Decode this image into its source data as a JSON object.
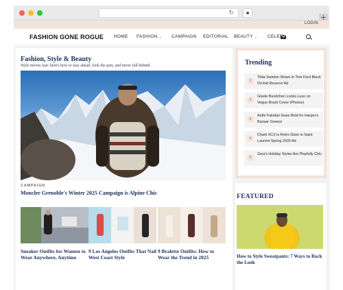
{
  "browser": {},
  "header": {
    "login": "LOGIN",
    "logo": "FASHION GONE ROGUE",
    "menu": {
      "home": "HOME",
      "fashion": "FASHION",
      "campaign": "CAMPAIGN",
      "editorial": "EDITORIAL",
      "beauty": "BEAUTY",
      "celeb": "CELEB"
    },
    "chevron": "⌄"
  },
  "main": {
    "section_title": "Fashion, Style & Beauty",
    "section_subtitle": "Style moves fast: here's how to stay ahead, look the part, and never fall behind.",
    "hero": {
      "label": "CAMPAIGN",
      "title": "Moncler Grenoble's Winter 2025 Campaign is Alpine Chic"
    },
    "cards": [
      {
        "title": "Sneaker Outfits for Women to Wear Anywhere, Anytime"
      },
      {
        "title": "9 Los Angeles Outfits That Nail West Coast Style"
      },
      {
        "title": "9 Bralette Outfits: How to Wear the Trend in 2025"
      }
    ]
  },
  "sidebar": {
    "trending_title": "Trending",
    "trending": [
      {
        "num": "1",
        "text": "Tilda Swinton Wows in Tom Ford Black Orchid Reserve Ad"
      },
      {
        "num": "2",
        "text": "Gisele Bundchen Looks Luxe on Vogue Brazil Cover (Photos)"
      },
      {
        "num": "3",
        "text": "Anthi Fakidari Goes Bold for Harper's Bazaar Greece"
      },
      {
        "num": "4",
        "text": "Charli XCX is Retro Glam in Saint Laurent Spring 2026 Ad"
      },
      {
        "num": "5",
        "text": "Zara's Holiday Styles Are Playfully Chic"
      }
    ],
    "featured_title": "FEATURED",
    "featured_caption": "How to Style Sweatpants: 7 Ways to Rock the Look"
  },
  "colors": {
    "accent_peach": "#f4e3da",
    "heading_navy": "#1e2f5a"
  }
}
